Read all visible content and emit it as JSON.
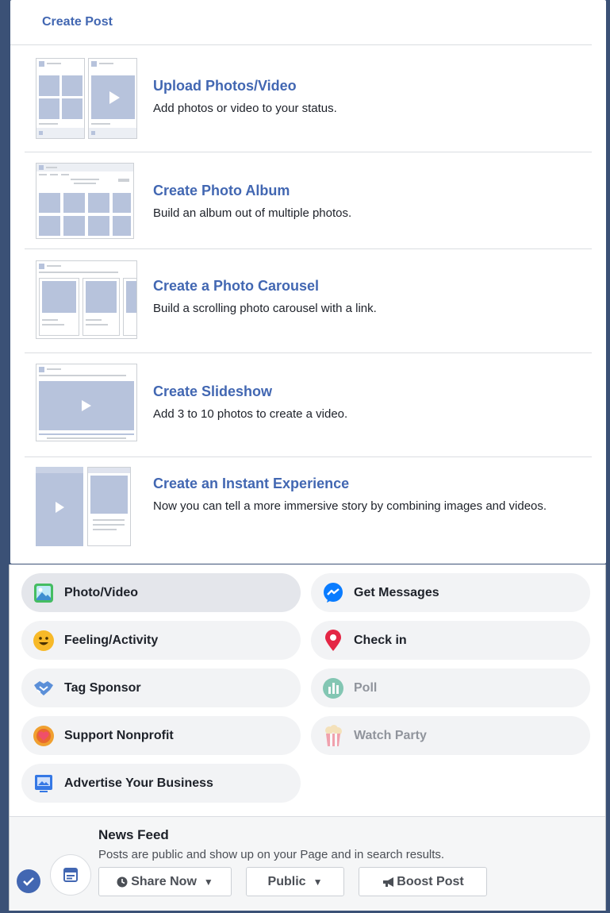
{
  "menu": {
    "title": "Create Post",
    "items": [
      {
        "title": "Upload Photos/Video",
        "desc": "Add photos or video to your status."
      },
      {
        "title": "Create Photo Album",
        "desc": "Build an album out of multiple photos."
      },
      {
        "title": "Create a Photo Carousel",
        "desc": "Build a scrolling photo carousel with a link."
      },
      {
        "title": "Create Slideshow",
        "desc": "Add 3 to 10 photos to create a video."
      },
      {
        "title": "Create an Instant Experience",
        "desc": "Now you can tell a more immersive story by combining images and videos."
      }
    ]
  },
  "actions": {
    "photo_video": "Photo/Video",
    "get_messages": "Get Messages",
    "feeling_activity": "Feeling/Activity",
    "check_in": "Check in",
    "tag_sponsor": "Tag Sponsor",
    "poll": "Poll",
    "support_nonprofit": "Support Nonprofit",
    "watch_party": "Watch Party",
    "advertise": "Advertise Your Business"
  },
  "news_feed": {
    "title": "News Feed",
    "desc": "Posts are public and show up on your Page and in search results.",
    "share_now": "Share Now",
    "audience": "Public",
    "boost": "Boost Post"
  },
  "colors": {
    "accent": "#4267b2",
    "thumb_fill": "#b7c3dc",
    "backdrop": "#3b5176"
  }
}
